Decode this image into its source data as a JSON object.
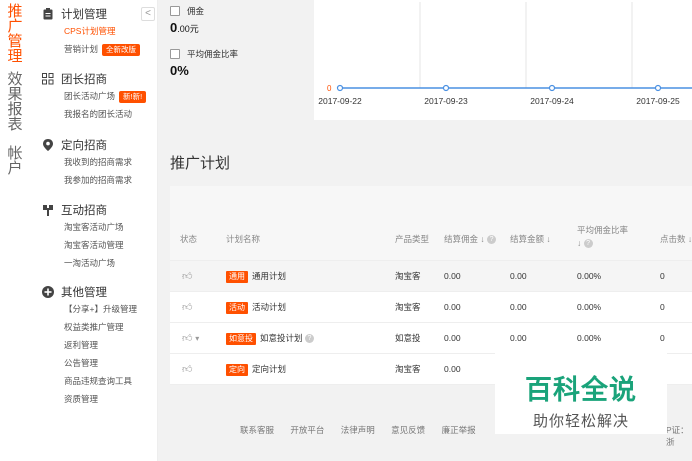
{
  "vnav": {
    "items": [
      {
        "label": "推广管理",
        "active": true
      },
      {
        "label": "效果报表",
        "active": false
      },
      {
        "label": "帐户",
        "active": false
      }
    ]
  },
  "sidebar": {
    "collapse_glyph": "<",
    "sections": [
      {
        "title": "计划管理",
        "icon": "clipboard-icon",
        "items": [
          {
            "label": "CPS计划管理",
            "active": true,
            "badge": ""
          },
          {
            "label": "营销计划",
            "active": false,
            "badge": "全新改版"
          }
        ]
      },
      {
        "title": "团长招商",
        "icon": "group-icon",
        "items": [
          {
            "label": "团长活动广场",
            "active": false,
            "badge": "新!新!"
          },
          {
            "label": "我报名的团长活动",
            "active": false,
            "badge": ""
          }
        ]
      },
      {
        "title": "定向招商",
        "icon": "location-icon",
        "items": [
          {
            "label": "我收到的招商需求",
            "active": false,
            "badge": ""
          },
          {
            "label": "我参加的招商需求",
            "active": false,
            "badge": ""
          }
        ]
      },
      {
        "title": "互动招商",
        "icon": "handshake-icon",
        "items": [
          {
            "label": "淘宝客活动广场",
            "active": false,
            "badge": ""
          },
          {
            "label": "淘宝客活动管理",
            "active": false,
            "badge": ""
          },
          {
            "label": "一淘活动广场",
            "active": false,
            "badge": ""
          }
        ]
      },
      {
        "title": "其他管理",
        "icon": "plus-circle-icon",
        "items": [
          {
            "label": "【分享+】升级管理",
            "active": false,
            "badge": ""
          },
          {
            "label": "权益类推广管理",
            "active": false,
            "badge": ""
          },
          {
            "label": "返利管理",
            "active": false,
            "badge": ""
          },
          {
            "label": "公告管理",
            "active": false,
            "badge": ""
          },
          {
            "label": "商品违规查询工具",
            "active": false,
            "badge": ""
          },
          {
            "label": "资质管理",
            "active": false,
            "badge": ""
          }
        ]
      }
    ]
  },
  "stats": {
    "commission": {
      "label": "佣金",
      "value": "0",
      "value_suffix": ".00元"
    },
    "avg_rate": {
      "label": "平均佣金比率",
      "value": "0%"
    }
  },
  "chart_data": {
    "type": "line",
    "x": [
      "2017-09-22",
      "2017-09-23",
      "2017-09-24",
      "2017-09-25"
    ],
    "series": [
      {
        "name": "",
        "values": [
          0,
          0,
          0,
          0
        ],
        "color": "#4a90e2"
      }
    ],
    "ylim": [
      0,
      1
    ],
    "y_tick_labels": [
      "0"
    ],
    "grid": true
  },
  "section_title": "推广计划",
  "table": {
    "columns": [
      "状态",
      "计划名称",
      "产品类型",
      "结算佣金",
      "结算金额",
      "平均佣金比率",
      "点击数"
    ],
    "rows": [
      {
        "tag": "通用",
        "name": "通用计划",
        "type": "淘宝客",
        "commission": "0.00",
        "amount": "0.00",
        "rate": "0.00%",
        "clicks": "0",
        "help": false,
        "dropdown": false
      },
      {
        "tag": "活动",
        "name": "活动计划",
        "type": "淘宝客",
        "commission": "0.00",
        "amount": "0.00",
        "rate": "0.00%",
        "clicks": "0",
        "help": false,
        "dropdown": false
      },
      {
        "tag": "如意投",
        "name": "如意投计划",
        "type": "如意投",
        "commission": "0.00",
        "amount": "0.00",
        "rate": "0.00%",
        "clicks": "0",
        "help": true,
        "dropdown": true
      },
      {
        "tag": "定向",
        "name": "定向计划",
        "type": "淘宝客",
        "commission": "0.00",
        "amount": "",
        "rate": "",
        "clicks": "",
        "help": false,
        "dropdown": false
      }
    ]
  },
  "footer": {
    "links": [
      "联系客服",
      "开放平台",
      "法律声明",
      "意见反馈",
      "廉正举报"
    ],
    "tail": "P证：浙"
  },
  "watermark": {
    "line1": "百科全说",
    "line2": "助你轻松解决"
  },
  "colors": {
    "accent": "#ff5000",
    "chart_line": "#4a90e2",
    "watermark": "#1aa37a"
  }
}
